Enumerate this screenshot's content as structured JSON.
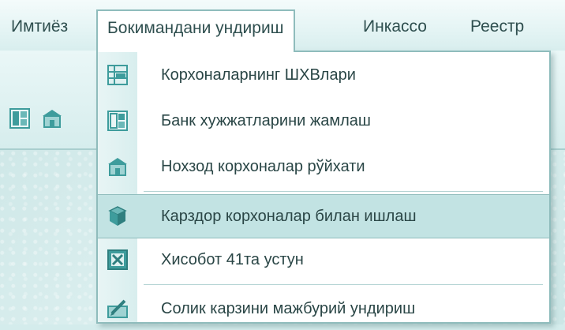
{
  "menubar": {
    "items": [
      {
        "label": "Имтиёз"
      },
      {
        "label": "Бокимандани ундириш"
      },
      {
        "label": "Инкассо"
      },
      {
        "label": "Реестр"
      }
    ]
  },
  "dropdown": {
    "items": [
      {
        "label": "Корхоналарнинг ШХВлари",
        "icon": "table-grid-icon"
      },
      {
        "label": "Банк хужжатларини жамлаш",
        "icon": "document-layout-icon"
      },
      {
        "label": "Нохзод корхоналар рўйхати",
        "icon": "building-list-icon"
      },
      {
        "label": "Карздор корхоналар билан ишлаш",
        "icon": "debtor-shield-icon",
        "highlighted": true
      },
      {
        "label": "Хисобот 41та устун",
        "icon": "spreadsheet-report-icon"
      },
      {
        "label": "Солик карзини мажбурий ундириш",
        "icon": "pen-document-icon"
      }
    ]
  },
  "colors": {
    "accent": "#8fbcbc",
    "highlight": "#c2e3e3",
    "text": "#2a4646",
    "icon_primary": "#3e9c9c"
  }
}
